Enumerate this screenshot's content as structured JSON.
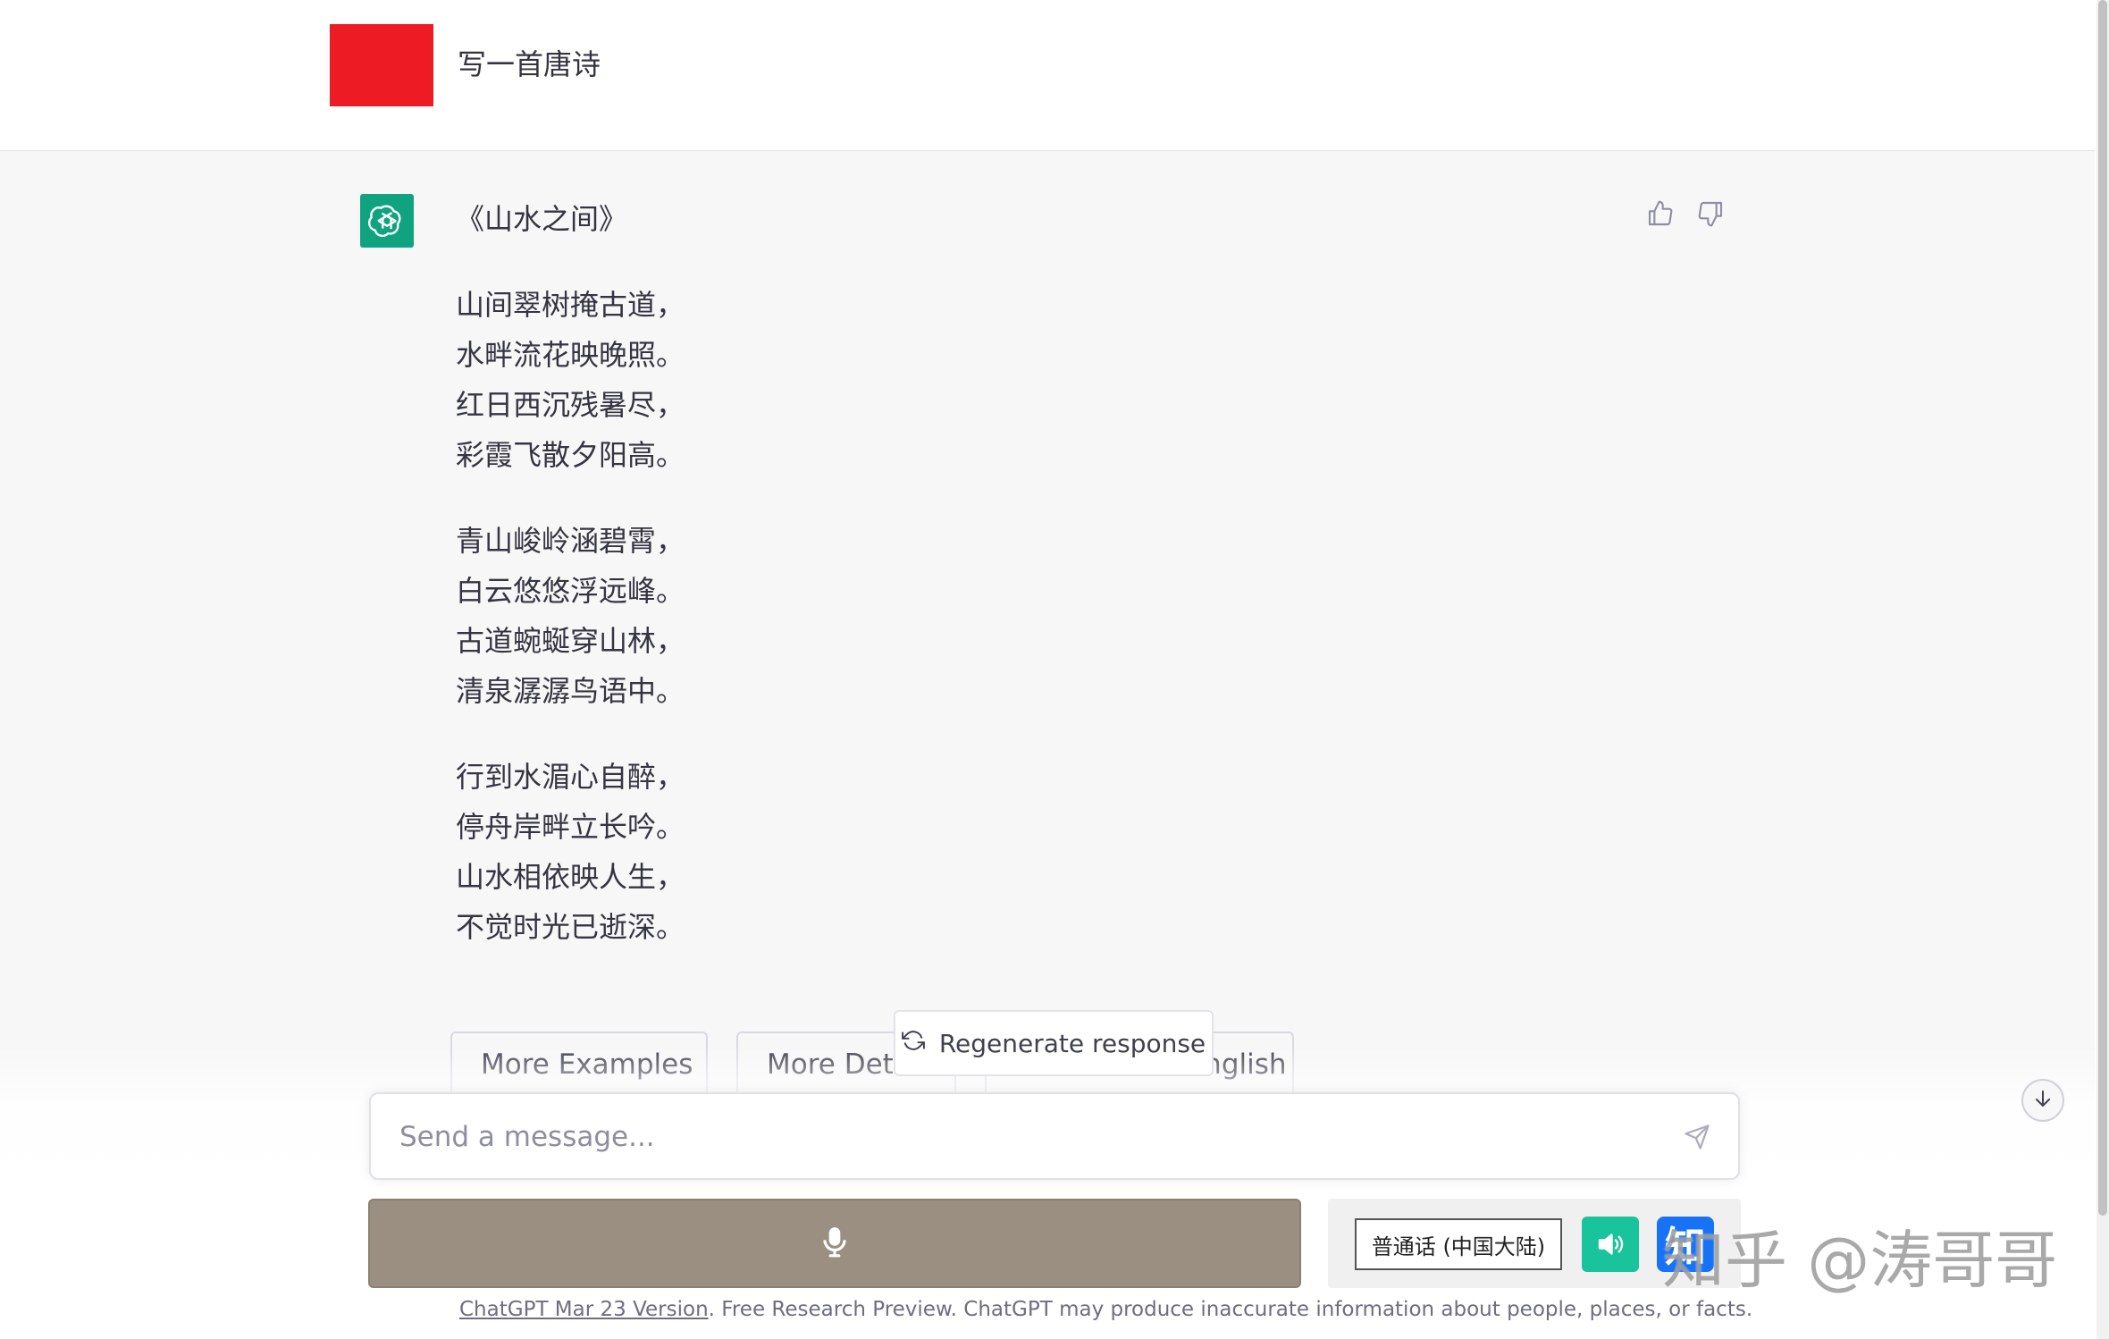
{
  "user_message": {
    "text": "写一首唐诗"
  },
  "assistant_message": {
    "title": "《山水之间》",
    "stanzas": [
      [
        "山间翠树掩古道，",
        "水畔流花映晚照。",
        "红日西沉残暑尽，",
        "彩霞飞散夕阳高。"
      ],
      [
        "青山峻岭涵碧霄，",
        "白云悠悠浮远峰。",
        "古道蜿蜒穿山林，",
        "清泉潺潺鸟语中。"
      ],
      [
        "行到水湄心自醉，",
        "停舟岸畔立长吟。",
        "山水相依映人生，",
        "不觉时光已逝深。"
      ]
    ]
  },
  "suggestions": {
    "examples": "More Examples",
    "details": "More Details",
    "translate": "Translate to English"
  },
  "regenerate_label": "Regenerate response",
  "input": {
    "placeholder": "Send a message..."
  },
  "voice": {
    "language": "普通话 (中国大陆)"
  },
  "watermark": "知乎 @涛哥哥",
  "zhihu_logo_char": "知",
  "footer": {
    "link": "ChatGPT Mar 23 Version",
    "text": ". Free Research Preview. ChatGPT may produce inaccurate information about people, places, or facts."
  },
  "colors": {
    "gpt_green": "#10a37f",
    "user_avatar": "#ed1c24",
    "mic_bar": "#9a8f80",
    "speaker": "#19c39b",
    "zhihu_blue": "#1772f6"
  },
  "icons": [
    "openai-logo-icon",
    "thumbs-up-icon",
    "thumbs-down-icon",
    "refresh-icon",
    "send-icon",
    "arrow-down-icon",
    "microphone-icon",
    "speaker-icon"
  ]
}
